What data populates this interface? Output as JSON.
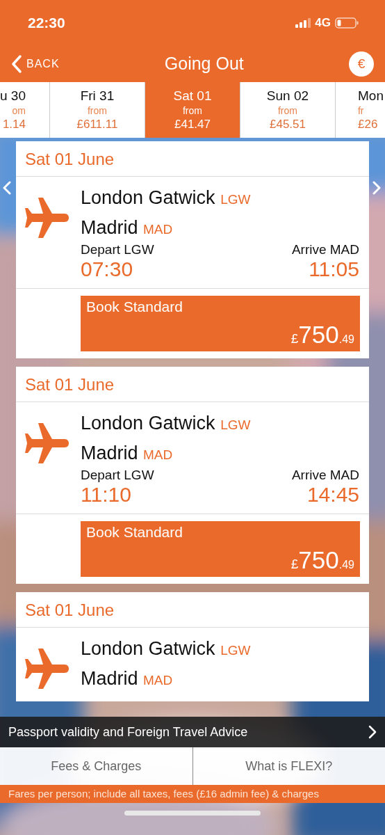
{
  "status_bar": {
    "time": "22:30",
    "network": "4G"
  },
  "nav": {
    "back": "BACK",
    "title": "Going Out",
    "currency": "€"
  },
  "date_tabs": [
    {
      "day": "u 30",
      "from": "om",
      "price": "1.14",
      "selected": false,
      "kind": "clipped-left"
    },
    {
      "day": "Fri 31",
      "from": "from",
      "price": "£611.11",
      "selected": false
    },
    {
      "day": "Sat 01",
      "from": "from",
      "price": "£41.47",
      "selected": true
    },
    {
      "day": "Sun 02",
      "from": "from",
      "price": "£45.51",
      "selected": false
    },
    {
      "day": "Mon",
      "from": "fr",
      "price": "£26",
      "selected": false,
      "kind": "clipped-right"
    }
  ],
  "flights": [
    {
      "date": "Sat 01 June",
      "origin": "London Gatwick",
      "origin_code": "LGW",
      "destination": "Madrid",
      "destination_code": "MAD",
      "depart_label": "Depart LGW",
      "depart_time": "07:30",
      "arrive_label": "Arrive MAD",
      "arrive_time": "11:05",
      "book": {
        "label": "Book Standard",
        "symbol": "£",
        "main": "750",
        "fraction": ".49"
      }
    },
    {
      "date": "Sat 01 June",
      "origin": "London Gatwick",
      "origin_code": "LGW",
      "destination": "Madrid",
      "destination_code": "MAD",
      "depart_label": "Depart LGW",
      "depart_time": "11:10",
      "arrive_label": "Arrive MAD",
      "arrive_time": "14:45",
      "book": {
        "label": "Book Standard",
        "symbol": "£",
        "main": "750",
        "fraction": ".49"
      }
    },
    {
      "date": "Sat 01 June",
      "origin": "London Gatwick",
      "origin_code": "LGW",
      "destination": "Madrid",
      "destination_code": "MAD"
    }
  ],
  "advice_bar": {
    "text": "Passport validity and Foreign Travel Advice"
  },
  "links": [
    "Fees & Charges",
    "What is FLEXI?"
  ],
  "fare_note": "Fares per person; include all taxes, fees (£16 admin fee) & charges"
}
